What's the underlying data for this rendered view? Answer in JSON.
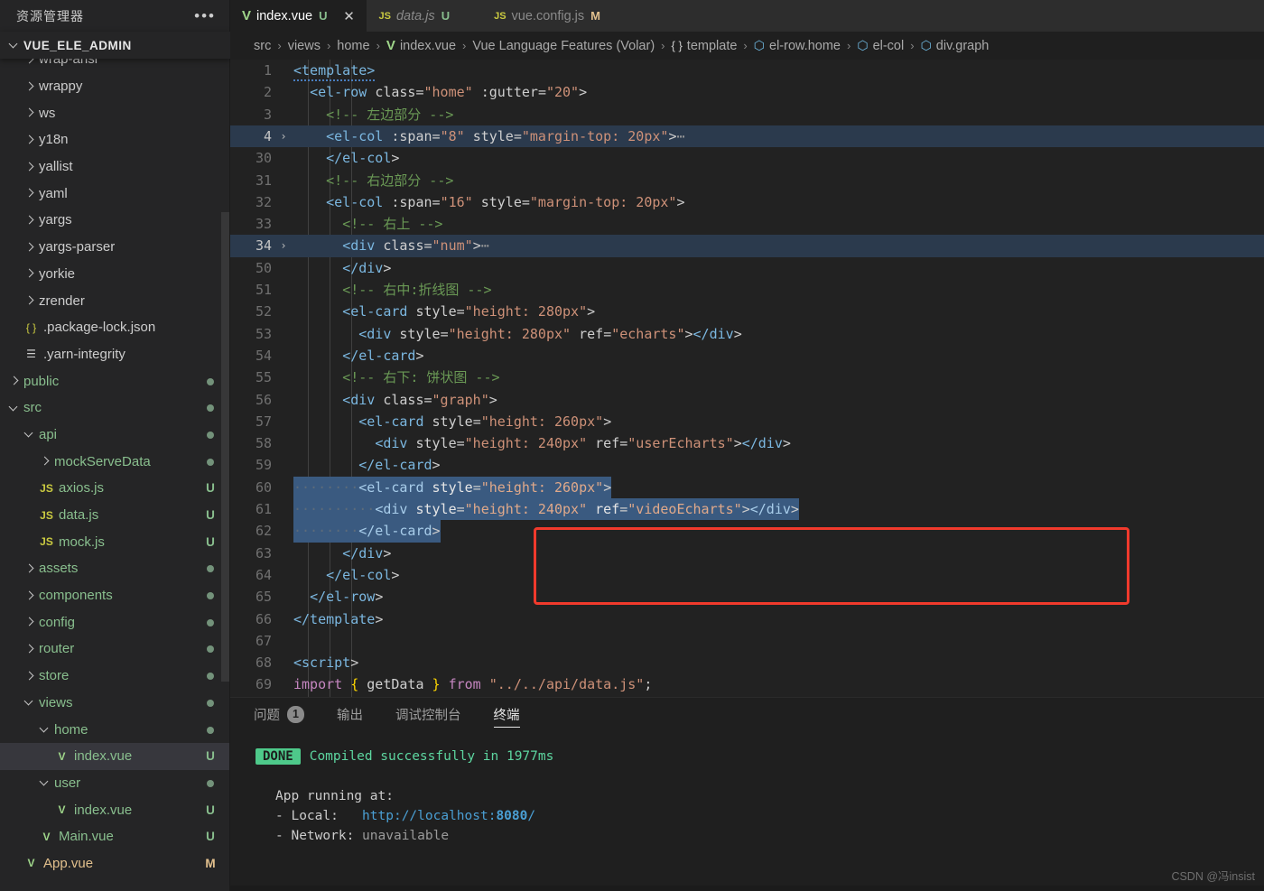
{
  "sidebar": {
    "header_title": "资源管理器",
    "more_icon": "ellipsis-icon",
    "root_label": "VUE_ELE_ADMIN",
    "items": [
      {
        "label": "wrap-ansi",
        "type": "folder",
        "indent": 1,
        "expanded": false,
        "badge": "",
        "color": "gray",
        "clipped": true
      },
      {
        "label": "wrappy",
        "type": "folder",
        "indent": 1,
        "expanded": false,
        "badge": "",
        "color": "gray"
      },
      {
        "label": "ws",
        "type": "folder",
        "indent": 1,
        "expanded": false,
        "badge": "",
        "color": "gray"
      },
      {
        "label": "y18n",
        "type": "folder",
        "indent": 1,
        "expanded": false,
        "badge": "",
        "color": "gray"
      },
      {
        "label": "yallist",
        "type": "folder",
        "indent": 1,
        "expanded": false,
        "badge": "",
        "color": "gray"
      },
      {
        "label": "yaml",
        "type": "folder",
        "indent": 1,
        "expanded": false,
        "badge": "",
        "color": "gray"
      },
      {
        "label": "yargs",
        "type": "folder",
        "indent": 1,
        "expanded": false,
        "badge": "",
        "color": "gray"
      },
      {
        "label": "yargs-parser",
        "type": "folder",
        "indent": 1,
        "expanded": false,
        "badge": "",
        "color": "gray"
      },
      {
        "label": "yorkie",
        "type": "folder",
        "indent": 1,
        "expanded": false,
        "badge": "",
        "color": "gray"
      },
      {
        "label": "zrender",
        "type": "folder",
        "indent": 1,
        "expanded": false,
        "badge": "",
        "color": "gray"
      },
      {
        "label": ".package-lock.json",
        "type": "json",
        "indent": 1,
        "badge": "",
        "color": "gray"
      },
      {
        "label": ".yarn-integrity",
        "type": "lines",
        "indent": 1,
        "badge": "",
        "color": "gray"
      },
      {
        "label": "public",
        "type": "folder",
        "indent": 0,
        "expanded": false,
        "badge": "dot",
        "color": "green"
      },
      {
        "label": "src",
        "type": "folder",
        "indent": 0,
        "expanded": true,
        "badge": "dot",
        "color": "green"
      },
      {
        "label": "api",
        "type": "folder",
        "indent": 1,
        "expanded": true,
        "badge": "dot",
        "color": "green"
      },
      {
        "label": "mockServeData",
        "type": "folder",
        "indent": 2,
        "expanded": false,
        "badge": "dot",
        "color": "green"
      },
      {
        "label": "axios.js",
        "type": "js",
        "indent": 2,
        "badge": "U",
        "color": "green"
      },
      {
        "label": "data.js",
        "type": "js",
        "indent": 2,
        "badge": "U",
        "color": "green"
      },
      {
        "label": "mock.js",
        "type": "js",
        "indent": 2,
        "badge": "U",
        "color": "green"
      },
      {
        "label": "assets",
        "type": "folder",
        "indent": 1,
        "expanded": false,
        "badge": "dot",
        "color": "green"
      },
      {
        "label": "components",
        "type": "folder",
        "indent": 1,
        "expanded": false,
        "badge": "dot",
        "color": "green"
      },
      {
        "label": "config",
        "type": "folder",
        "indent": 1,
        "expanded": false,
        "badge": "dot",
        "color": "green"
      },
      {
        "label": "router",
        "type": "folder",
        "indent": 1,
        "expanded": false,
        "badge": "dot",
        "color": "green"
      },
      {
        "label": "store",
        "type": "folder",
        "indent": 1,
        "expanded": false,
        "badge": "dot",
        "color": "green"
      },
      {
        "label": "views",
        "type": "folder",
        "indent": 1,
        "expanded": true,
        "badge": "dot",
        "color": "green"
      },
      {
        "label": "home",
        "type": "folder",
        "indent": 2,
        "expanded": true,
        "badge": "dot",
        "color": "green"
      },
      {
        "label": "index.vue",
        "type": "vue",
        "indent": 3,
        "badge": "U",
        "color": "green",
        "selected": true
      },
      {
        "label": "user",
        "type": "folder",
        "indent": 2,
        "expanded": true,
        "badge": "dot",
        "color": "green"
      },
      {
        "label": "index.vue",
        "type": "vue",
        "indent": 3,
        "badge": "U",
        "color": "green"
      },
      {
        "label": "Main.vue",
        "type": "vue",
        "indent": 2,
        "badge": "U",
        "color": "green"
      },
      {
        "label": "App.vue",
        "type": "vue",
        "indent": 1,
        "badge": "M",
        "color": "orange"
      }
    ]
  },
  "tabs": [
    {
      "name": "index.vue",
      "icon": "vue-icon",
      "status": "U",
      "active": true,
      "preview": false,
      "closable": true
    },
    {
      "name": "data.js",
      "icon": "js-icon",
      "status": "U",
      "active": false,
      "preview": true,
      "closable": false
    },
    {
      "name": "vue.config.js",
      "icon": "js-icon",
      "status": "M",
      "active": false,
      "preview": false,
      "closable": false
    }
  ],
  "breadcrumb": [
    {
      "label": "src",
      "icon": ""
    },
    {
      "label": "views",
      "icon": ""
    },
    {
      "label": "home",
      "icon": ""
    },
    {
      "label": "index.vue",
      "icon": "vue-icon"
    },
    {
      "label": "Vue Language Features (Volar)",
      "icon": ""
    },
    {
      "label": "template",
      "icon": "braces-icon"
    },
    {
      "label": "el-row.home",
      "icon": "cube-icon"
    },
    {
      "label": "el-col",
      "icon": "cube-icon"
    },
    {
      "label": "div.graph",
      "icon": "cube-icon"
    }
  ],
  "code": {
    "lines": [
      {
        "num": "1",
        "text": "<template>"
      },
      {
        "num": "2",
        "text": "  <el-row class=\"home\" :gutter=\"20\">"
      },
      {
        "num": "3",
        "text": "    <!-- 左边部分 -->"
      },
      {
        "num": "4",
        "text": "    <el-col :span=\"8\" style=\"margin-top: 20px\">⋯",
        "current": true,
        "fold": true
      },
      {
        "num": "30",
        "text": "    </el-col>"
      },
      {
        "num": "31",
        "text": "    <!-- 右边部分 -->"
      },
      {
        "num": "32",
        "text": "    <el-col :span=\"16\" style=\"margin-top: 20px\">"
      },
      {
        "num": "33",
        "text": "      <!-- 右上 -->"
      },
      {
        "num": "34",
        "text": "      <div class=\"num\">⋯",
        "current": true,
        "fold": true
      },
      {
        "num": "50",
        "text": "      </div>"
      },
      {
        "num": "51",
        "text": "      <!-- 右中:折线图 -->"
      },
      {
        "num": "52",
        "text": "      <el-card style=\"height: 280px\">"
      },
      {
        "num": "53",
        "text": "        <div style=\"height: 280px\" ref=\"echarts\"></div>"
      },
      {
        "num": "54",
        "text": "      </el-card>"
      },
      {
        "num": "55",
        "text": "      <!-- 右下: 饼状图 -->"
      },
      {
        "num": "56",
        "text": "      <div class=\"graph\">"
      },
      {
        "num": "57",
        "text": "        <el-card style=\"height: 260px\">"
      },
      {
        "num": "58",
        "text": "          <div style=\"height: 240px\" ref=\"userEcharts\"></div>"
      },
      {
        "num": "59",
        "text": "        </el-card>"
      },
      {
        "num": "60",
        "text": "        <el-card style=\"height: 260px\">",
        "selected": true
      },
      {
        "num": "61",
        "text": "          <div style=\"height: 240px\" ref=\"videoEcharts\"></div>",
        "selected": true
      },
      {
        "num": "62",
        "text": "        </el-card>",
        "selected": true
      },
      {
        "num": "63",
        "text": "      </div>"
      },
      {
        "num": "64",
        "text": "    </el-col>"
      },
      {
        "num": "65",
        "text": "  </el-row>"
      },
      {
        "num": "66",
        "text": "</template>"
      },
      {
        "num": "67",
        "text": ""
      },
      {
        "num": "68",
        "text": "<script>"
      },
      {
        "num": "69",
        "text": "import { getData } from \"../../api/data.js\";"
      }
    ],
    "annotation": {
      "name": "red-highlight-box",
      "color": "#f13a2c"
    }
  },
  "panel": {
    "tabs": [
      {
        "label": "问题",
        "badge": "1",
        "active": false
      },
      {
        "label": "输出",
        "badge": "",
        "active": false
      },
      {
        "label": "调试控制台",
        "badge": "",
        "active": false
      },
      {
        "label": "终端",
        "badge": "",
        "active": true
      }
    ],
    "terminal": {
      "status_badge": "DONE",
      "status_text": "Compiled successfully in 1977ms",
      "app_running_label": "App running at:",
      "local_label": "- Local:",
      "local_url_prefix": "http://localhost:",
      "local_url_port": "8080",
      "local_url_suffix": "/",
      "network_label": "- Network:",
      "network_value": "unavailable"
    }
  },
  "watermark": "CSDN @冯insist",
  "colors": {
    "accent_red": "#f13a2c",
    "selection_blue": "#3a5a80",
    "current_line": "#2b3a4d",
    "git_untracked": "#89bf8e",
    "git_modified": "#e2c08d",
    "terminal_success": "#4ec98a"
  }
}
